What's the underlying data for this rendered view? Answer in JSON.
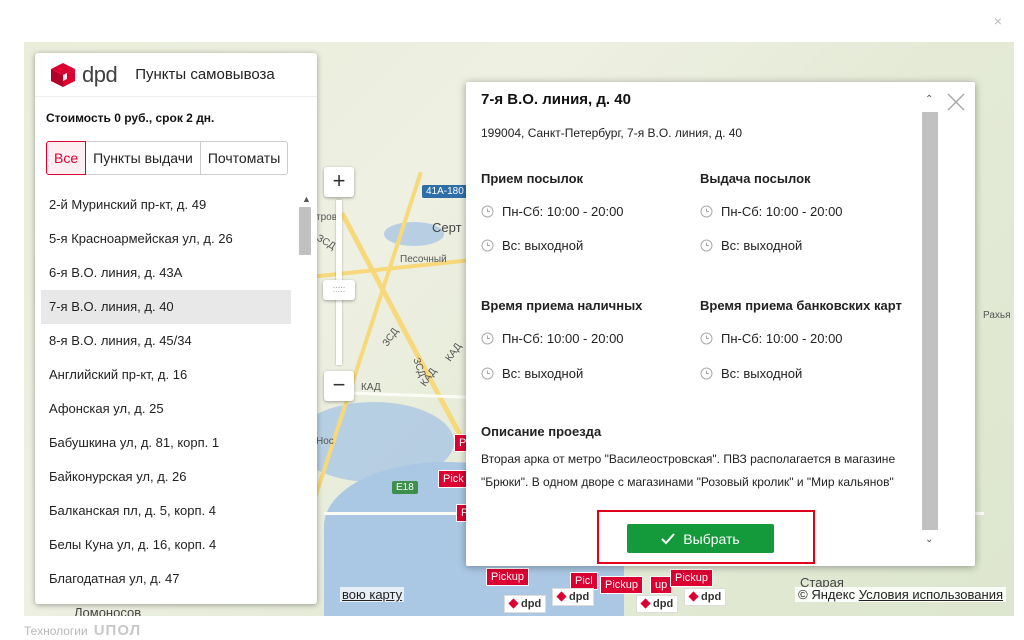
{
  "page": {
    "close_glyph": "×"
  },
  "map": {
    "labels": [
      "Серт",
      "Песочный",
      "Рахья",
      "Старая",
      "Ломоносов",
      "Нос",
      "тров"
    ],
    "road_badges": [
      "41А-180",
      "E18"
    ],
    "road_labels": [
      "ЗСД",
      "КАД",
      "ЗСД",
      "КАД",
      "КАД",
      "ЗСД"
    ],
    "zoom_in": "+",
    "zoom_out": "−",
    "zoom_handle": ":::::",
    "footer_link": "вою карту",
    "copyright_prefix": "© Яндекс",
    "copyright_link": "Условия использования",
    "marker_text": "Pickup",
    "marker_short": "Pick",
    "marker_short2": "Picl",
    "marker_tail": "up",
    "marker_logo": "dpd",
    "colors": {
      "brand": "#dc0032",
      "water": "#aac7e3",
      "road": "#f7d87a"
    }
  },
  "left_panel": {
    "logo_text": "dpd",
    "title": "Пункты самовывоза",
    "cost": "Стоимость 0 руб., срок 2 дн.",
    "tabs": [
      "Все",
      "Пункты выдачи",
      "Почтоматы"
    ],
    "active_tab": "Все",
    "items": [
      "2-й Муринский пр-кт, д. 49",
      "5-я Красноармейская ул, д. 26",
      "6-я В.О. линия, д. 43А",
      "7-я В.О. линия, д. 40",
      "8-я В.О. линия, д. 45/34",
      "Английский пр-кт, д. 16",
      "Афонская ул, д. 25",
      "Бабушкина ул, д. 81, корп. 1",
      "Байконурская ул, д. 26",
      "Балканская пл, д. 5, корп. 4",
      "Белы Куна ул, д. 16, корп. 4",
      "Благодатная ул, д. 47"
    ],
    "selected_item": "7-я В.О. линия, д. 40",
    "scroll_up": "▲"
  },
  "detail": {
    "title": "7-я В.О. линия, д. 40",
    "address": "199004, Санкт-Петербург, 7-я В.О. линия, д. 40",
    "sections": {
      "receive": {
        "title": "Прием посылок",
        "rows": [
          "Пн-Сб: 10:00 - 20:00",
          "Вс: выходной"
        ]
      },
      "issue": {
        "title": "Выдача посылок",
        "rows": [
          "Пн-Сб: 10:00 - 20:00",
          "Вс: выходной"
        ]
      },
      "cash": {
        "title": "Время приема наличных",
        "rows": [
          "Пн-Сб: 10:00 - 20:00",
          "Вс: выходной"
        ]
      },
      "cards": {
        "title": "Время приема банковских карт",
        "rows": [
          "Пн-Сб: 10:00 - 20:00",
          "Вс: выходной"
        ]
      }
    },
    "description_title": "Описание проезда",
    "description": "Вторая арка от метро \"Василеостровская\". ПВЗ располагается в магазине \"Брюки\". В одном дворе с магазинами \"Розовый кролик\" и \"Мир кальянов\"",
    "select_button": "Выбрать",
    "scroll_up": "⌃",
    "scroll_down": "⌄",
    "button_color": "#149a3a",
    "highlight_color": "#e0001b"
  },
  "footer": {
    "powered_by": "Технологии",
    "upop_logo": "UПОЛ"
  }
}
